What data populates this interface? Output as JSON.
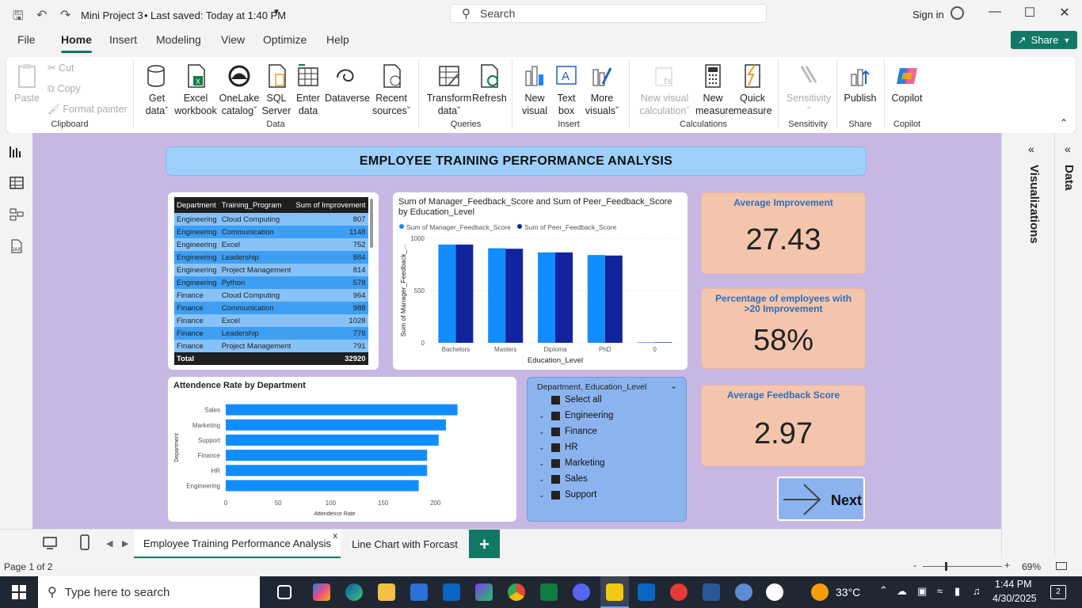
{
  "titlebar": {
    "file_title": "Mini Project 3",
    "saved_status": "Last saved: Today at 1:40 PM",
    "search_placeholder": "Search",
    "sign_in": "Sign in"
  },
  "menu": {
    "items": [
      "File",
      "Home",
      "Insert",
      "Modeling",
      "View",
      "Optimize",
      "Help"
    ],
    "share": "Share"
  },
  "ribbon": {
    "clipboard": {
      "paste": "Paste",
      "cut": "Cut",
      "copy": "Copy",
      "format_painter": "Format painter",
      "label": "Clipboard"
    },
    "data": {
      "get_data": "Get",
      "get_data2": "data",
      "excel": "Excel",
      "excel2": "workbook",
      "onelake": "OneLake",
      "onelake2": "catalog",
      "sql": "SQL",
      "sql2": "Server",
      "enter": "Enter",
      "enter2": "data",
      "dataverse": "Dataverse",
      "recent": "Recent",
      "recent2": "sources",
      "label": "Data"
    },
    "queries": {
      "transform": "Transform",
      "transform2": "data",
      "refresh": "Refresh",
      "label": "Queries"
    },
    "insert": {
      "new_visual": "New",
      "new_visual2": "visual",
      "text_box": "Text",
      "text_box2": "box",
      "more": "More",
      "more2": "visuals",
      "label": "Insert"
    },
    "calculations": {
      "new_visual_calc": "New visual",
      "new_visual_calc2": "calculation",
      "new_measure": "New",
      "new_measure2": "measure",
      "quick": "Quick",
      "quick2": "measure",
      "label": "Calculations"
    },
    "sensitivity": {
      "btn": "Sensitivity",
      "label": "Sensitivity"
    },
    "share": {
      "publish": "Publish",
      "label": "Share"
    },
    "copilot": {
      "btn": "Copilot",
      "label": "Copilot"
    }
  },
  "report": {
    "title": "EMPLOYEE TRAINING PERFORMANCE ANALYSIS",
    "matrix": {
      "headers": [
        "Department",
        "Training_Program",
        "Sum of Improvement"
      ],
      "rows": [
        [
          "Engineering",
          "Cloud Computing",
          "807"
        ],
        [
          "Engineering",
          "Communication",
          "1148"
        ],
        [
          "Engineering",
          "Excel",
          "752"
        ],
        [
          "Engineering",
          "Leadership",
          "884"
        ],
        [
          "Engineering",
          "Project Management",
          "814"
        ],
        [
          "Engineering",
          "Python",
          "578"
        ],
        [
          "Finance",
          "Cloud Computing",
          "964"
        ],
        [
          "Finance",
          "Communication",
          "988"
        ],
        [
          "Finance",
          "Excel",
          "1028"
        ],
        [
          "Finance",
          "Leadership",
          "778"
        ],
        [
          "Finance",
          "Project Management",
          "791"
        ]
      ],
      "total_label": "Total",
      "total_value": "32920"
    },
    "kpis": [
      {
        "label": "Average Improvement",
        "value": "27.43"
      },
      {
        "label": "Percentage of employees with >20 Improvement",
        "value": "58%"
      },
      {
        "label": "Average Feedback Score",
        "value": "2.97"
      }
    ],
    "slicer": {
      "title": "Department, Education_Level",
      "items": [
        "Select all",
        "Engineering",
        "Finance",
        "HR",
        "Marketing",
        "Sales",
        "Support"
      ]
    },
    "next_button": "Next"
  },
  "chart_data": [
    {
      "type": "bar",
      "title": "Sum of Manager_Feedback_Score and Sum of Peer_Feedback_Score by Education_Level",
      "xlabel": "Education_Level",
      "ylabel": "Sum of Manager_Feedback_...",
      "categories": [
        "Bachelors",
        "Masters",
        "Diploma",
        "PhD",
        "0"
      ],
      "series": [
        {
          "name": "Sum of Manager_Feedback_Score",
          "values": [
            940,
            905,
            865,
            840,
            5
          ]
        },
        {
          "name": "Sum of Peer_Feedback_Score",
          "values": [
            940,
            900,
            865,
            835,
            5
          ]
        }
      ],
      "ylim": [
        0,
        1000
      ],
      "yticks": [
        "0",
        "500",
        "1000"
      ],
      "colors": [
        "#118dff",
        "#12239e"
      ],
      "legend": "top-left"
    },
    {
      "type": "bar",
      "orientation": "horizontal",
      "title": "Attendence Rate by Department",
      "xlabel": "Attendence Rate",
      "ylabel": "Department",
      "categories": [
        "Sales",
        "Marketing",
        "Support",
        "Finance",
        "HR",
        "Engineering"
      ],
      "values": [
        221,
        210,
        203,
        192,
        192,
        184
      ],
      "xlim": [
        0,
        250
      ],
      "xticks": [
        "0",
        "50",
        "100",
        "150",
        "200"
      ],
      "colors": [
        "#118dff"
      ]
    }
  ],
  "tabs": {
    "pages": [
      "Employee Training Performance Analysis",
      "Line Chart with Forcast"
    ],
    "close": "x",
    "add": "+"
  },
  "panes": {
    "visualizations": "Visualizations",
    "data": "Data"
  },
  "status": {
    "page": "Page 1 of 2",
    "zoom": "69%"
  },
  "taskbar": {
    "search": "Type here to search",
    "temp": "33°C",
    "time": "1:44 PM",
    "date": "4/30/2025",
    "notif": "2"
  }
}
